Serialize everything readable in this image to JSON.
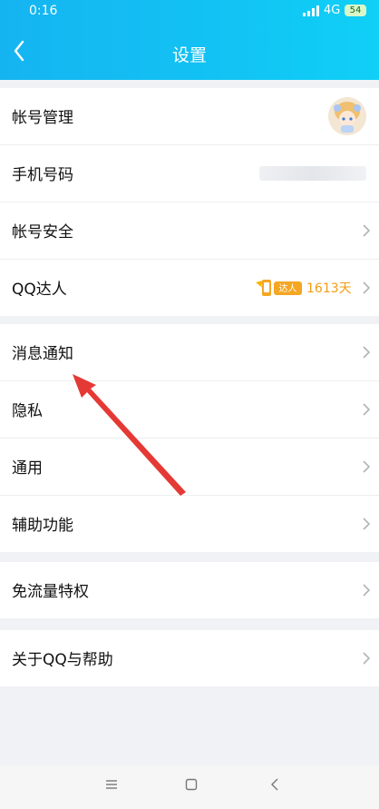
{
  "status": {
    "time": "0:16",
    "network": "4G",
    "battery": "54"
  },
  "header": {
    "title": "设置"
  },
  "groups": [
    {
      "items": [
        {
          "label": "帐号管理"
        },
        {
          "label": "手机号码"
        },
        {
          "label": "帐号安全"
        },
        {
          "label": "QQ达人",
          "badge_text": "达人",
          "badge_days": "1613天"
        }
      ]
    },
    {
      "items": [
        {
          "label": "消息通知"
        },
        {
          "label": "隐私"
        },
        {
          "label": "通用"
        },
        {
          "label": "辅助功能"
        }
      ]
    },
    {
      "items": [
        {
          "label": "免流量特权"
        }
      ]
    },
    {
      "items": [
        {
          "label": "关于QQ与帮助"
        }
      ]
    }
  ],
  "colors": {
    "header": "#12c3f4",
    "accent": "#f39c12",
    "arrow": "#e53935"
  }
}
